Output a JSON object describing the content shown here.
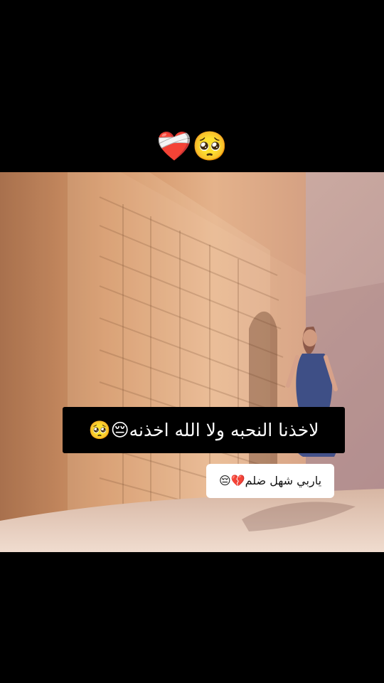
{
  "overlay": {
    "top_emojis": "❤️‍🩹🥺",
    "caption_main": "لاخذنا النحبه ولا الله اخذنه😔🥺",
    "caption_sub": "ياربي شهل ضلم💔😔"
  },
  "colors": {
    "background": "#000000",
    "caption_main_bg": "#000000",
    "caption_sub_bg": "#ffffff"
  }
}
